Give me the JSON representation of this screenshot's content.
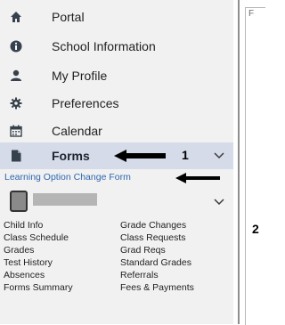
{
  "nav": {
    "items": [
      {
        "id": "portal",
        "label": "Portal",
        "icon": "home-icon"
      },
      {
        "id": "school-information",
        "label": "School Information",
        "icon": "info-icon"
      },
      {
        "id": "my-profile",
        "label": "My Profile",
        "icon": "user-icon"
      },
      {
        "id": "preferences",
        "label": "Preferences",
        "icon": "gear-icon"
      },
      {
        "id": "calendar",
        "label": "Calendar",
        "icon": "calendar-icon"
      },
      {
        "id": "forms",
        "label": "Forms",
        "icon": "document-icon"
      }
    ],
    "active": "forms",
    "forms_sublink": "Learning Option Change Form"
  },
  "annotations": {
    "marker1": "1",
    "marker2": "2"
  },
  "student": {
    "links_col1": [
      "Child Info",
      "Class Schedule",
      "Grades",
      "Test History",
      "Absences",
      "Forms Summary"
    ],
    "links_col2": [
      "Grade Changes",
      "Class Requests",
      "Grad Reqs",
      "Standard Grades",
      "Referrals",
      "Fees & Payments"
    ]
  },
  "right_pane": {
    "tab_initial": "F"
  },
  "colors": {
    "sidebar_bg": "#f1f1f1",
    "active_bg": "#d5dbe8",
    "link": "#2f67b0"
  }
}
